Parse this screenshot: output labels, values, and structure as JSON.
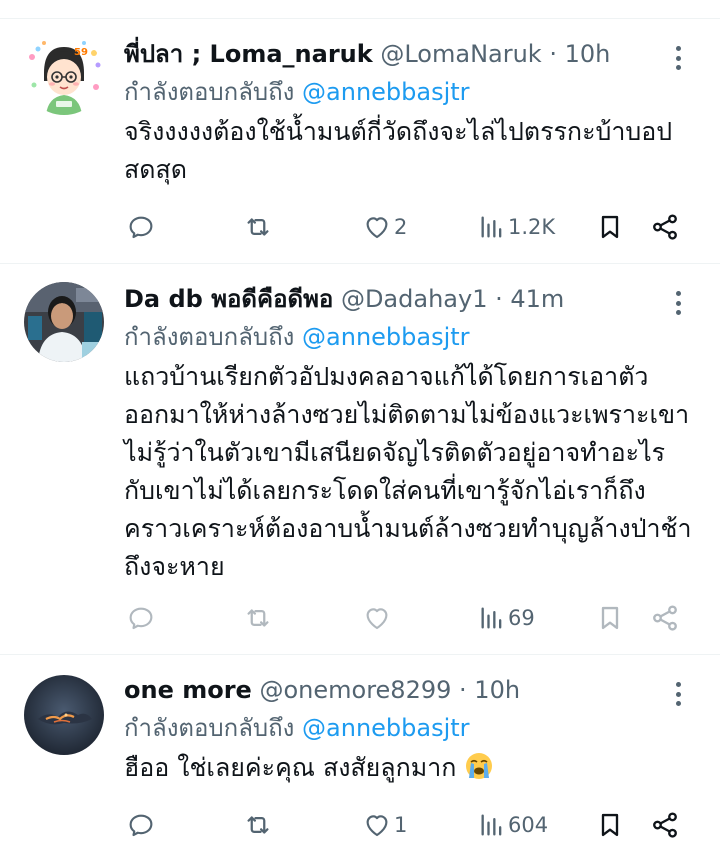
{
  "tweets": [
    {
      "display_name": "พี่ปลา ; Loma_naruk",
      "handle": "@LomaNaruk",
      "dot": "·",
      "time": "10h",
      "reply_prefix": "กำลังตอบกลับถึง",
      "reply_to": "@annebbasjtr",
      "text": "จริงงงงงต้องใช้น้ำมนต์กี่วัดถึงจะไล่ไปตรรกะบ้าบอปสดสุด",
      "likes": "2",
      "views": "1.2K",
      "avatar_icon": "cartoon-avatar"
    },
    {
      "display_name": "Da db พอดีคือดีพอ",
      "handle": "@Dadahay1",
      "dot": "·",
      "time": "41m",
      "reply_prefix": "กำลังตอบกลับถึง",
      "reply_to": "@annebbasjtr",
      "text": "แถวบ้านเรียกตัวอัปมงคลอาจแก้ได้โดยการเอาตัวออกมาให้ห่างล้างซวยไม่ติดตามไม่ข้องแวะเพราะเขาไม่รู้ว่าในตัวเขามีเสนียดจัญไรติดตัวอยู่อาจทำอะไรกับเขาไม่ได้เลยกระโดดใส่คนที่เขารู้จักไอ่เราก็ถึงคราวเคราะห์ต้องอาบน้ำมนต์ล้างซวยทำบุญล้างป่าช้าถึงจะหาย",
      "likes": "",
      "views": "69",
      "avatar_icon": "photo-avatar"
    },
    {
      "display_name": "one more",
      "handle": "@onemore8299",
      "dot": "·",
      "time": "10h",
      "reply_prefix": "กำลังตอบกลับถึง",
      "reply_to": "@annebbasjtr",
      "text": "ฮืออ ใช่เลยค่ะคุณ สงสัยลูกมาก",
      "likes": "1",
      "views": "604",
      "avatar_icon": "sunset-sky-avatar",
      "emoji": "loudly-crying-face"
    }
  ],
  "colors": {
    "text": "#0f1419",
    "secondary": "#536471",
    "link": "#1d9bf0",
    "divider": "#eff3f4"
  }
}
